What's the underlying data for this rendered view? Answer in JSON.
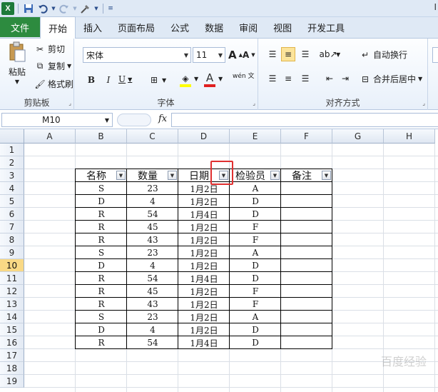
{
  "app": {
    "title_partial": "I"
  },
  "qat": {
    "logo": "X",
    "save_icon": "save-icon",
    "undo_icon": "undo-icon",
    "redo_icon": "redo-icon",
    "customize_icon": "customize-icon"
  },
  "tabs": [
    {
      "label": "文件"
    },
    {
      "label": "开始"
    },
    {
      "label": "插入"
    },
    {
      "label": "页面布局"
    },
    {
      "label": "公式"
    },
    {
      "label": "数据"
    },
    {
      "label": "审阅"
    },
    {
      "label": "视图"
    },
    {
      "label": "开发工具"
    }
  ],
  "active_tab": "开始",
  "ribbon": {
    "clipboard": {
      "paste": "粘贴",
      "cut": "剪切",
      "copy": "复制",
      "format_painter": "格式刷",
      "label": "剪贴板"
    },
    "font": {
      "name": "宋体",
      "size": "11",
      "bold": "B",
      "italic": "I",
      "underline": "U",
      "label": "字体",
      "grow": "A",
      "shrink": "A",
      "font_color_letter": "A",
      "phonetic": "wén 文"
    },
    "align": {
      "wrap": "自动换行",
      "merge": "合并后居中",
      "label": "对齐方式"
    }
  },
  "formula_bar": {
    "name_box": "M10",
    "fx": "fx",
    "value": ""
  },
  "columns": [
    "A",
    "B",
    "C",
    "D",
    "E",
    "F",
    "G",
    "H"
  ],
  "rows": [
    "1",
    "2",
    "3",
    "4",
    "5",
    "6",
    "7",
    "8",
    "9",
    "10",
    "11",
    "12",
    "13",
    "14",
    "15",
    "16",
    "17",
    "18",
    "19"
  ],
  "selected_row": "10",
  "table": {
    "headers": [
      "名称",
      "数量",
      "日期",
      "检验员",
      "备注"
    ],
    "rows": [
      [
        "S",
        "23",
        "1月2日",
        "A",
        ""
      ],
      [
        "D",
        "4",
        "1月2日",
        "D",
        ""
      ],
      [
        "R",
        "54",
        "1月4日",
        "D",
        ""
      ],
      [
        "R",
        "45",
        "1月2日",
        "F",
        ""
      ],
      [
        "R",
        "43",
        "1月2日",
        "F",
        ""
      ],
      [
        "S",
        "23",
        "1月2日",
        "A",
        ""
      ],
      [
        "D",
        "4",
        "1月2日",
        "D",
        ""
      ],
      [
        "R",
        "54",
        "1月4日",
        "D",
        ""
      ],
      [
        "R",
        "45",
        "1月2日",
        "F",
        ""
      ],
      [
        "R",
        "43",
        "1月2日",
        "F",
        ""
      ],
      [
        "S",
        "23",
        "1月2日",
        "A",
        ""
      ],
      [
        "D",
        "4",
        "1月2日",
        "D",
        ""
      ],
      [
        "R",
        "54",
        "1月4日",
        "D",
        ""
      ]
    ]
  },
  "highlight_color": "#e03030",
  "watermark": "百度经验"
}
